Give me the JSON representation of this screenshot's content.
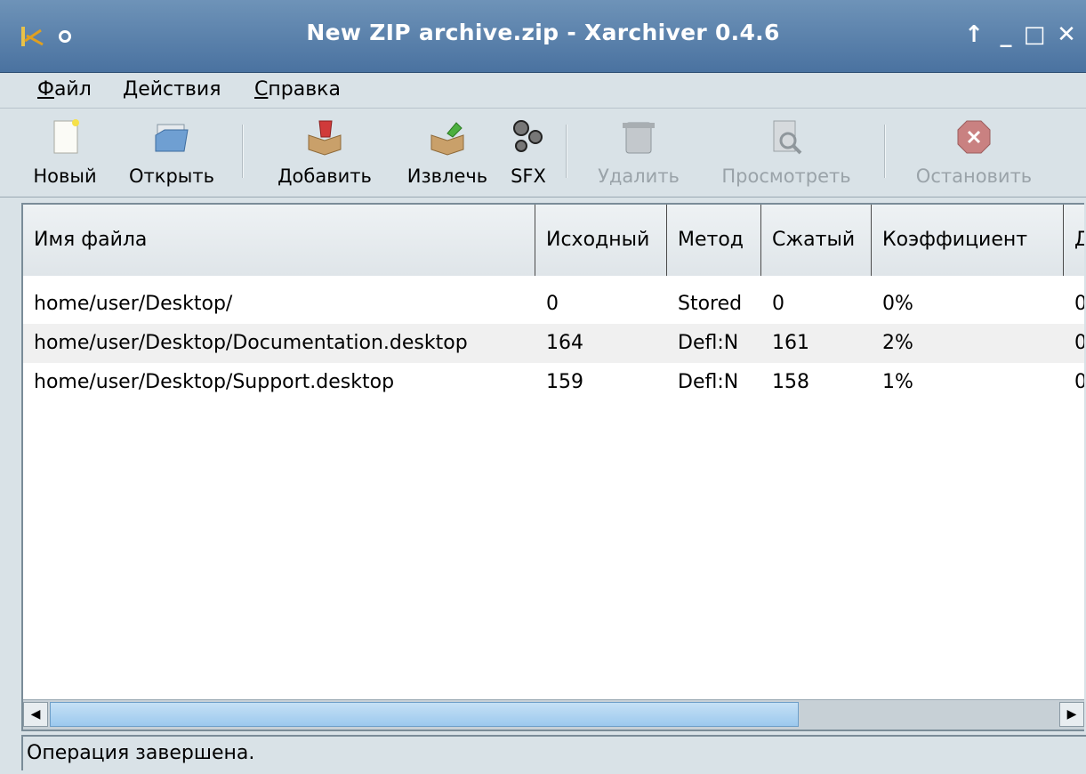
{
  "window": {
    "title": "New ZIP archive.zip - Xarchiver 0.4.6",
    "icons": {
      "app": "xarchiver-icon",
      "menu": "window-menu-icon",
      "up": "arrow-up-icon",
      "minimize": "minimize-icon",
      "maximize": "maximize-icon",
      "close": "close-icon"
    }
  },
  "menubar": {
    "file": {
      "accel": "Ф",
      "rest": "айл"
    },
    "actions": {
      "accel": "Д",
      "rest": "ействия"
    },
    "help": {
      "accel": "С",
      "rest": "правка"
    }
  },
  "toolbar": {
    "new": "Новый",
    "open": "Открыть",
    "add": "Добавить",
    "extract": "Извлечь",
    "sfx": "SFX",
    "delete": "Удалить",
    "view": "Просмотреть",
    "stop": "Остановить"
  },
  "columns": [
    "Имя файла",
    "Исходный",
    "Метод",
    "Сжатый",
    "Коэффициент",
    "Д"
  ],
  "rows": [
    {
      "name": "home/user/Desktop/",
      "original": "0",
      "method": "Stored",
      "compressed": "0",
      "ratio": "0%",
      "extra": "0"
    },
    {
      "name": "home/user/Desktop/Documentation.desktop",
      "original": "164",
      "method": "Defl:N",
      "compressed": "161",
      "ratio": "2%",
      "extra": "0"
    },
    {
      "name": "home/user/Desktop/Support.desktop",
      "original": "159",
      "method": "Defl:N",
      "compressed": "158",
      "ratio": "1%",
      "extra": "0"
    }
  ],
  "status": "Операция завершена.",
  "colors": {
    "titlebar": "#5a82ab",
    "window_bg": "#d9e2e7",
    "scroll_thumb": "#9cc9ee"
  }
}
